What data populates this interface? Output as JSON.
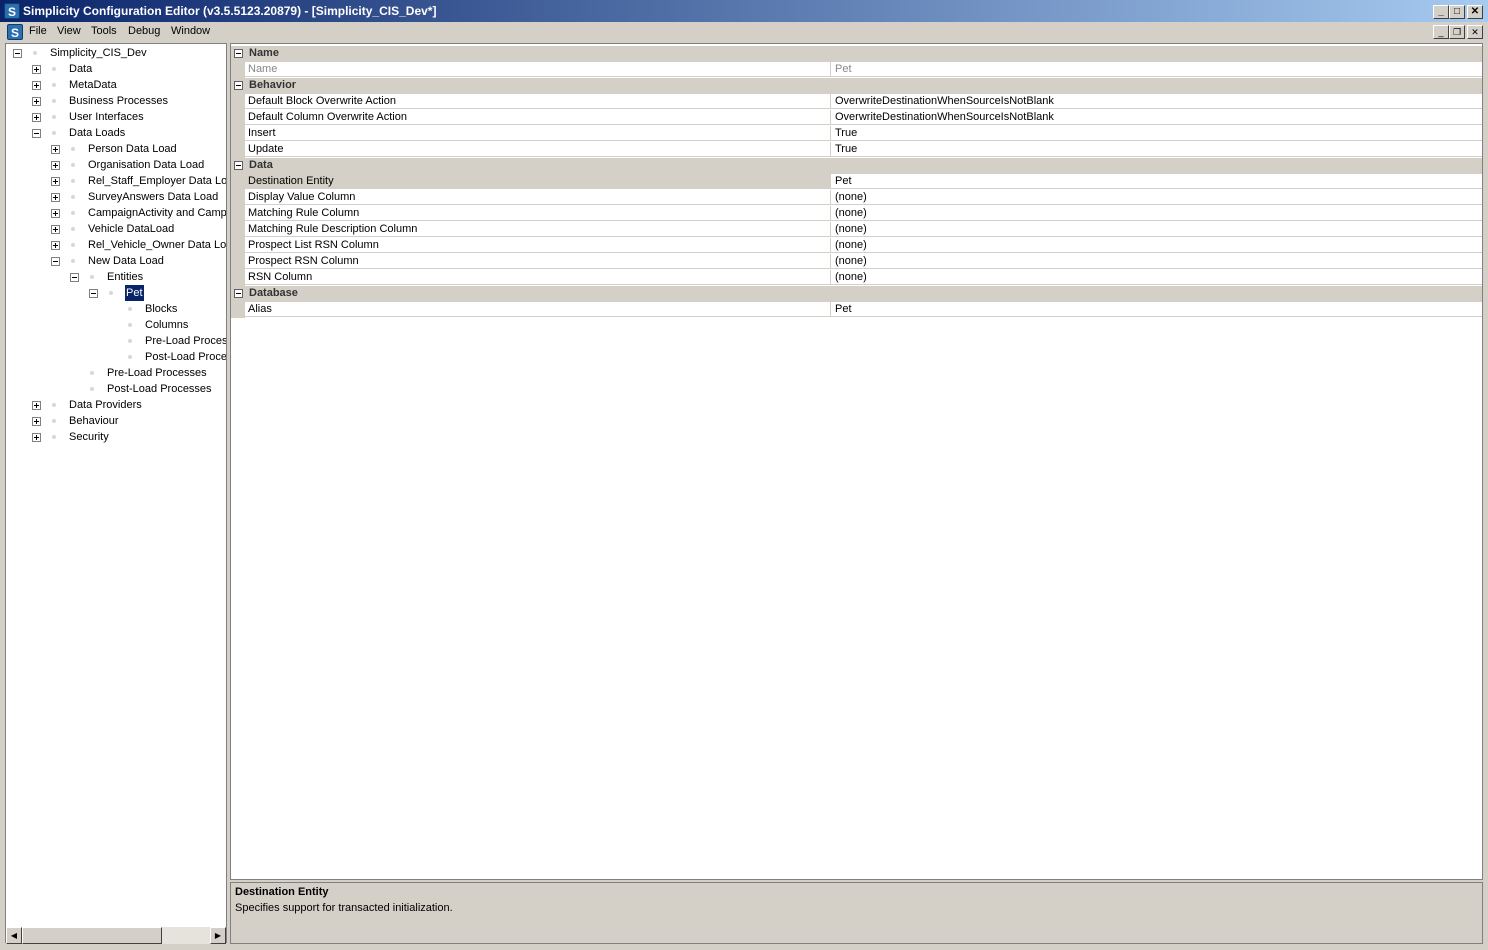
{
  "window": {
    "title": "Simplicity Configuration Editor (v3.5.5123.20879) - [Simplicity_CIS_Dev*]",
    "app_icon_glyph": "S",
    "caption_buttons": {
      "minimize": "_",
      "maximize": "□",
      "close": "✕"
    },
    "mdi_buttons": {
      "minimize": "_",
      "restore": "❐",
      "close": "✕"
    }
  },
  "menubar": {
    "items": [
      "File",
      "View",
      "Tools",
      "Debug",
      "Window"
    ]
  },
  "tree": {
    "nodes": [
      {
        "label": "Simplicity_CIS_Dev",
        "level": 0,
        "expander": "minus"
      },
      {
        "label": "Data",
        "level": 1,
        "expander": "plus"
      },
      {
        "label": "MetaData",
        "level": 1,
        "expander": "plus"
      },
      {
        "label": "Business Processes",
        "level": 1,
        "expander": "plus"
      },
      {
        "label": "User Interfaces",
        "level": 1,
        "expander": "plus"
      },
      {
        "label": "Data Loads",
        "level": 1,
        "expander": "minus"
      },
      {
        "label": "Person Data Load",
        "level": 2,
        "expander": "plus"
      },
      {
        "label": "Organisation Data Load",
        "level": 2,
        "expander": "plus"
      },
      {
        "label": "Rel_Staff_Employer Data Load",
        "level": 2,
        "expander": "plus"
      },
      {
        "label": "SurveyAnswers Data Load",
        "level": 2,
        "expander": "plus"
      },
      {
        "label": "CampaignActivity and Campaign",
        "level": 2,
        "expander": "plus"
      },
      {
        "label": "Vehicle DataLoad",
        "level": 2,
        "expander": "plus"
      },
      {
        "label": "Rel_Vehicle_Owner Data Load",
        "level": 2,
        "expander": "plus"
      },
      {
        "label": "New Data Load",
        "level": 2,
        "expander": "minus"
      },
      {
        "label": "Entities",
        "level": 3,
        "expander": "minus"
      },
      {
        "label": "Pet",
        "level": 4,
        "expander": "minus",
        "selected": true
      },
      {
        "label": "Blocks",
        "level": 5,
        "expander": "none"
      },
      {
        "label": "Columns",
        "level": 5,
        "expander": "none"
      },
      {
        "label": "Pre-Load Processes",
        "level": 5,
        "expander": "none"
      },
      {
        "label": "Post-Load Processes",
        "level": 5,
        "expander": "none"
      },
      {
        "label": "Pre-Load Processes",
        "level": 3,
        "expander": "none"
      },
      {
        "label": "Post-Load Processes",
        "level": 3,
        "expander": "none"
      },
      {
        "label": "Data Providers",
        "level": 1,
        "expander": "plus"
      },
      {
        "label": "Behaviour",
        "level": 1,
        "expander": "plus"
      },
      {
        "label": "Security",
        "level": 1,
        "expander": "plus"
      }
    ],
    "scroll_left_glyph": "◀",
    "scroll_right_glyph": "▶"
  },
  "property_grid": {
    "rows": [
      {
        "type": "category",
        "label": "Name"
      },
      {
        "type": "property",
        "name": "Name",
        "value": "Pet",
        "readonly": true
      },
      {
        "type": "category",
        "label": "Behavior"
      },
      {
        "type": "property",
        "name": "Default Block Overwrite Action",
        "value": "OverwriteDestinationWhenSourceIsNotBlank"
      },
      {
        "type": "property",
        "name": "Default Column Overwrite Action",
        "value": "OverwriteDestinationWhenSourceIsNotBlank"
      },
      {
        "type": "property",
        "name": "Insert",
        "value": "True"
      },
      {
        "type": "property",
        "name": "Update",
        "value": "True"
      },
      {
        "type": "category",
        "label": "Data"
      },
      {
        "type": "property",
        "name": "Destination Entity",
        "value": "Pet",
        "selected": true
      },
      {
        "type": "property",
        "name": "Display Value Column",
        "value": "(none)"
      },
      {
        "type": "property",
        "name": "Matching Rule Column",
        "value": "(none)"
      },
      {
        "type": "property",
        "name": "Matching Rule Description Column",
        "value": "(none)"
      },
      {
        "type": "property",
        "name": "Prospect List RSN Column",
        "value": "(none)"
      },
      {
        "type": "property",
        "name": "Prospect RSN Column",
        "value": "(none)"
      },
      {
        "type": "property",
        "name": "RSN Column",
        "value": "(none)"
      },
      {
        "type": "category",
        "label": "Database"
      },
      {
        "type": "property",
        "name": "Alias",
        "value": "Pet"
      }
    ]
  },
  "description": {
    "title": "Destination Entity",
    "text": "Specifies support for transacted initialization."
  }
}
